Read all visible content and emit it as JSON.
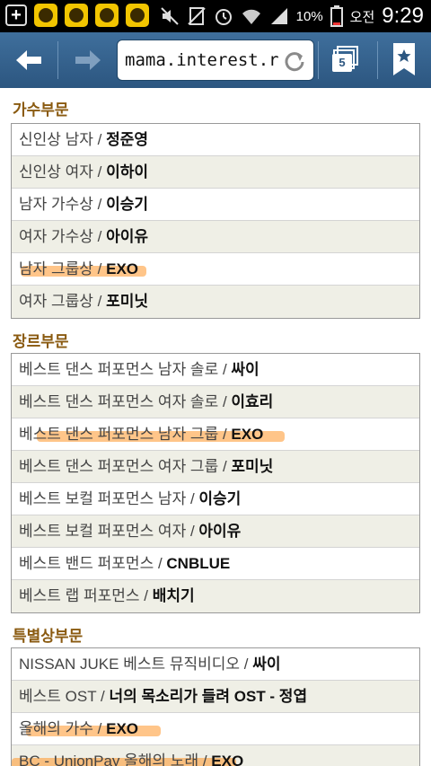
{
  "status_bar": {
    "battery": "10%",
    "ampm": "오전",
    "time": "9:29"
  },
  "browser": {
    "url": "mama.interest.r",
    "tab_count": "5"
  },
  "sections": [
    {
      "title": "가수부문",
      "items": [
        {
          "category": "신인상 남자",
          "winner": "정준영"
        },
        {
          "category": "신인상 여자",
          "winner": "이하이"
        },
        {
          "category": "남자 가수상",
          "winner": "이승기"
        },
        {
          "category": "여자 가수상",
          "winner": "아이유"
        },
        {
          "category": "남자 그룹상",
          "winner": "EXO"
        },
        {
          "category": "여자 그룹상",
          "winner": "포미닛"
        }
      ]
    },
    {
      "title": "장르부문",
      "items": [
        {
          "category": "베스트 댄스 퍼포먼스 남자 솔로",
          "winner": "싸이"
        },
        {
          "category": "베스트 댄스 퍼포먼스 여자 솔로",
          "winner": "이효리"
        },
        {
          "category": "베스트 댄스 퍼포먼스 남자 그룹",
          "winner": "EXO"
        },
        {
          "category": "베스트 댄스 퍼포먼스 여자 그룹",
          "winner": "포미닛"
        },
        {
          "category": "베스트 보컬 퍼포먼스 남자",
          "winner": "이승기"
        },
        {
          "category": "베스트 보컬 퍼포먼스 여자",
          "winner": "아이유"
        },
        {
          "category": "베스트 밴드 퍼포먼스",
          "winner": "CNBLUE"
        },
        {
          "category": "베스트 랩 퍼포먼스",
          "winner": "배치기"
        }
      ]
    },
    {
      "title": "특별상부문",
      "items": [
        {
          "category": "NISSAN JUKE 베스트 뮤직비디오",
          "winner": "싸이"
        },
        {
          "category": "베스트 OST",
          "winner": "너의 목소리가 들려 OST - 정엽"
        },
        {
          "category": "올해의 가수",
          "winner": "EXO"
        },
        {
          "category": "BC - UnionPay 올해의 노래",
          "winner": "EXO"
        }
      ]
    }
  ]
}
